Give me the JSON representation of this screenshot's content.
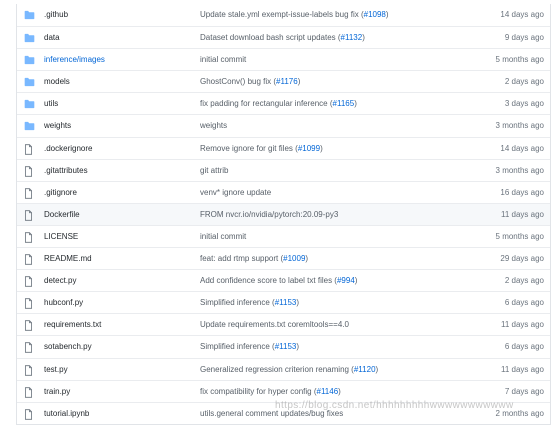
{
  "files": [
    {
      "type": "folder",
      "name": ".github",
      "msg": "Update stale.yml exempt-issue-labels bug fix (",
      "pr": "#1098",
      "msg_end": ")",
      "age": "14 days ago"
    },
    {
      "type": "folder",
      "name": "data",
      "msg": "Dataset download bash script updates (",
      "pr": "#1132",
      "msg_end": ")",
      "age": "9 days ago"
    },
    {
      "type": "folder",
      "name": "inference/",
      "name_tail": "images",
      "msg": "initial commit",
      "age": "5 months ago"
    },
    {
      "type": "folder",
      "name": "models",
      "msg": "GhostConv() bug fix (",
      "pr": "#1176",
      "msg_end": ")",
      "age": "2 days ago"
    },
    {
      "type": "folder",
      "name": "utils",
      "msg": "fix padding for rectangular inference (",
      "pr": "#1165",
      "msg_end": ")",
      "age": "3 days ago"
    },
    {
      "type": "folder",
      "name": "weights",
      "msg": "weights",
      "age": "3 months ago"
    },
    {
      "type": "file",
      "name": ".dockerignore",
      "msg": "Remove ignore for git files (",
      "pr": "#1099",
      "msg_end": ")",
      "age": "14 days ago"
    },
    {
      "type": "file",
      "name": ".gitattributes",
      "msg": "git attrib",
      "age": "3 months ago"
    },
    {
      "type": "file",
      "name": ".gitignore",
      "msg": "venv* ignore update",
      "age": "16 days ago"
    },
    {
      "type": "file",
      "name": "Dockerfile",
      "msg": "FROM nvcr.io/nvidia/pytorch:20.09-py3",
      "age": "11 days ago"
    },
    {
      "type": "file",
      "name": "LICENSE",
      "msg": "initial commit",
      "age": "5 months ago"
    },
    {
      "type": "file",
      "name": "README.md",
      "msg": "feat: add rtmp support (",
      "pr": "#1009",
      "msg_end": ")",
      "age": "29 days ago"
    },
    {
      "type": "file",
      "name": "detect.py",
      "msg": "Add confidence score to label txt files (",
      "pr": "#994",
      "msg_end": ")",
      "age": "2 days ago"
    },
    {
      "type": "file",
      "name": "hubconf.py",
      "msg": "Simplified inference (",
      "pr": "#1153",
      "msg_end": ")",
      "age": "6 days ago"
    },
    {
      "type": "file",
      "name": "requirements.txt",
      "msg": "Update requirements.txt coremltools==4.0",
      "age": "11 days ago"
    },
    {
      "type": "file",
      "name": "sotabench.py",
      "msg": "Simplified inference (",
      "pr": "#1153",
      "msg_end": ")",
      "age": "6 days ago"
    },
    {
      "type": "file",
      "name": "test.py",
      "msg": "Generalized regression criterion renaming (",
      "pr": "#1120",
      "msg_end": ")",
      "age": "11 days ago"
    },
    {
      "type": "file",
      "name": "train.py",
      "msg": "fix compatibility for hyper config (",
      "pr": "#1146",
      "msg_end": ")",
      "age": "7 days ago"
    },
    {
      "type": "file",
      "name": "tutorial.ipynb",
      "msg": "utils.general comment updates/bug fixes",
      "age": "2 months ago"
    }
  ],
  "highlight_row": 9,
  "watermark": "https://blog.csdn.net/hhhhhhhhhwwwwwwwwwww",
  "colors": {
    "folder": "#79b8ff",
    "link": "#0366d6",
    "file_icon": "#6a737d"
  }
}
